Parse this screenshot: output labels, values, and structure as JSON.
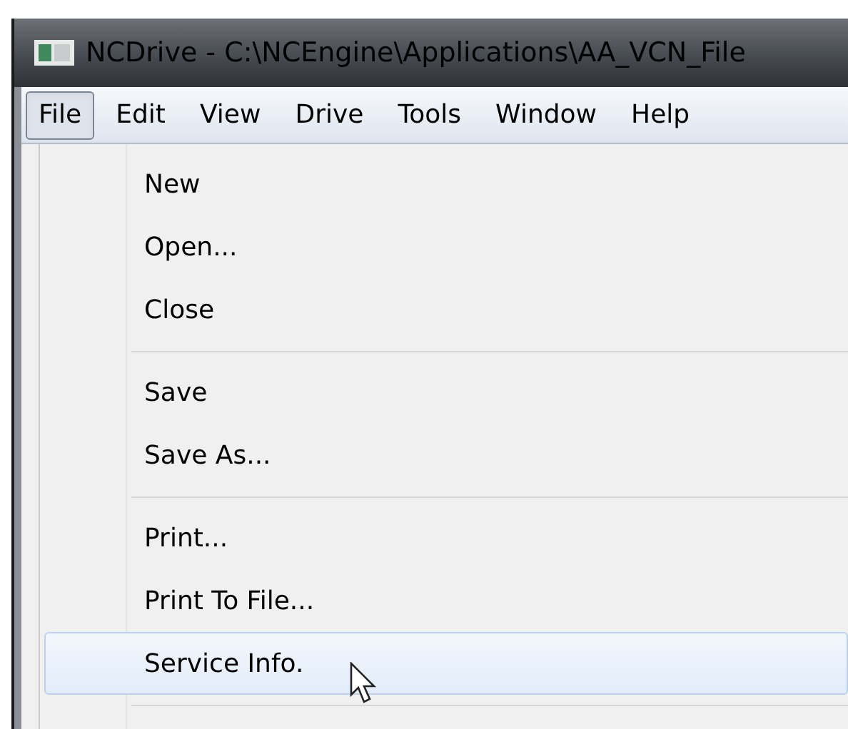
{
  "window": {
    "title": "NCDrive - C:\\NCEngine\\Applications\\AA_VCN_File"
  },
  "menu_bar": [
    {
      "label": "File",
      "selected": true
    },
    {
      "label": "Edit",
      "selected": false
    },
    {
      "label": "View",
      "selected": false
    },
    {
      "label": "Drive",
      "selected": false
    },
    {
      "label": "Tools",
      "selected": false
    },
    {
      "label": "Window",
      "selected": false
    },
    {
      "label": "Help",
      "selected": false
    }
  ],
  "menu": [
    {
      "kind": "item",
      "label": "New",
      "selected": false
    },
    {
      "kind": "item",
      "label": "Open...",
      "selected": false
    },
    {
      "kind": "item",
      "label": "Close",
      "selected": false
    },
    {
      "kind": "separator"
    },
    {
      "kind": "item",
      "label": "Save",
      "selected": false
    },
    {
      "kind": "item",
      "label": "Save As...",
      "selected": false
    },
    {
      "kind": "separator"
    },
    {
      "kind": "item",
      "label": "Print...",
      "selected": false
    },
    {
      "kind": "item",
      "label": "Print To File...",
      "selected": false
    },
    {
      "kind": "item",
      "label": "Service Info.",
      "selected": true
    },
    {
      "kind": "separator"
    }
  ]
}
